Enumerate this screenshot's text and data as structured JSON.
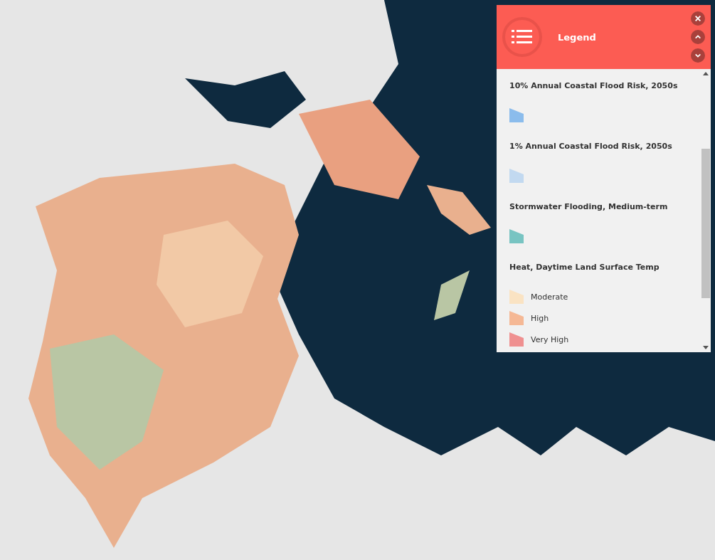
{
  "legend": {
    "title": "Legend",
    "layers": [
      {
        "title": "10% Annual Coastal Flood Risk, 2050s",
        "items": [
          {
            "color": "#8bbcec"
          }
        ]
      },
      {
        "title": "1% Annual Coastal Flood Risk, 2050s",
        "items": [
          {
            "color": "#c2d9f0"
          }
        ]
      },
      {
        "title": "Stormwater Flooding, Medium-term",
        "items": [
          {
            "color": "#78c4c2"
          }
        ]
      },
      {
        "title": "Heat, Daytime Land Surface Temp",
        "items": [
          {
            "color": "#fae3c3",
            "label": "Moderate"
          },
          {
            "color": "#f5b895",
            "label": "High"
          },
          {
            "color": "#ef9090",
            "label": "Very High"
          }
        ]
      }
    ]
  }
}
